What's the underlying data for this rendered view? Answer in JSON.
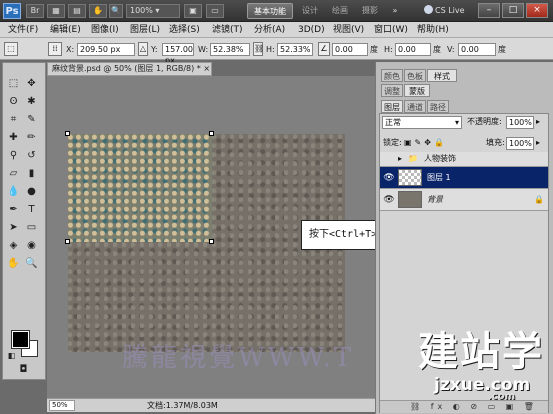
{
  "titlebar": {
    "logo": "Ps",
    "zoom": "100%",
    "workspace": [
      "基本功能",
      "设计",
      "绘画",
      "摄影"
    ],
    "cs_live": "CS Live",
    "controls": [
      "–",
      "□",
      "×"
    ]
  },
  "menu": [
    "文件(F)",
    "编辑(E)",
    "图像(I)",
    "图层(L)",
    "选择(S)",
    "滤镜(T)",
    "分析(A)",
    "3D(D)",
    "视图(V)",
    "窗口(W)",
    "帮助(H)"
  ],
  "options": {
    "x_label": "X:",
    "x_value": "209.50 px",
    "y_label": "Y:",
    "y_value": "157.00 px",
    "w_label": "W:",
    "w_value": "52.38%",
    "h_label": "H:",
    "h_value": "52.33%",
    "angle_value": "0.00",
    "angle_unit": "度",
    "hskew_label": "H:",
    "hskew_value": "0.00",
    "hskew_unit": "度",
    "vskew_label": "V:",
    "vskew_value": "0.00",
    "vskew_unit": "度"
  },
  "document": {
    "tab_title": "麻纹背景.psd @ 50% (图层 1, RGB/8) *",
    "callout": "按下<Ctrl+T>键打开自由变换框并调整",
    "watermark": "騰龍視覺WWW.T",
    "status_zoom": "50%",
    "status_doc": "文档:1.37M/8.03M"
  },
  "panels": {
    "top_tabs": [
      "颜色",
      "色板",
      "样式"
    ],
    "mid_tabs": [
      "调整",
      "蒙版"
    ],
    "layer_tabs": [
      "图层",
      "通道",
      "路径"
    ],
    "blend_mode": "正常",
    "opacity_label": "不透明度:",
    "opacity_value": "100%",
    "lock_label": "锁定:",
    "fill_label": "填充:",
    "fill_value": "100%",
    "layers": [
      {
        "name": "人物装饰",
        "type": "group"
      },
      {
        "name": "图层 1",
        "type": "layer"
      },
      {
        "name": "背景",
        "type": "background"
      }
    ],
    "bottom_icons": "⛓ fx ◐ ⊘ ▭ ▣ 🗑"
  },
  "brand": {
    "name": "建站学",
    "url": "jzxue.com",
    "suffix": ".com"
  },
  "colors": {
    "accent_selected": "#0a246a",
    "foreground": "#000000",
    "background": "#ffffff"
  }
}
